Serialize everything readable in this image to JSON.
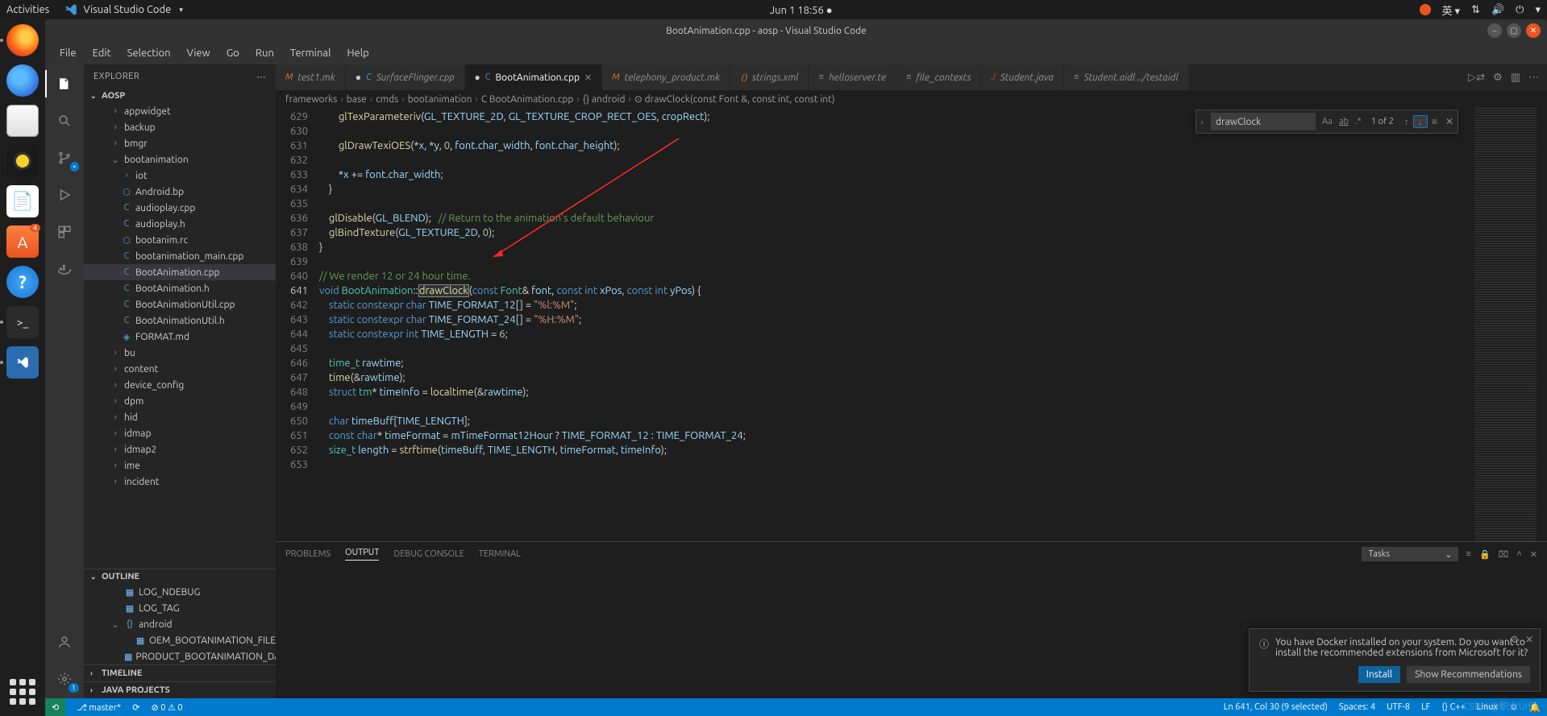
{
  "gnome": {
    "activities": "Activities",
    "app": "Visual Studio Code",
    "clock": "Jun 1  18:56",
    "lang": "英"
  },
  "window": {
    "title": "BootAnimation.cpp - aosp - Visual Studio Code"
  },
  "menu": [
    "File",
    "Edit",
    "Selection",
    "View",
    "Go",
    "Run",
    "Terminal",
    "Help"
  ],
  "explorer": {
    "title": "EXPLORER",
    "section": "AOSP",
    "items": [
      {
        "t": "appwidget",
        "d": 1,
        "k": "fold"
      },
      {
        "t": "backup",
        "d": 1,
        "k": "fold"
      },
      {
        "t": "bmgr",
        "d": 1,
        "k": "fold"
      },
      {
        "t": "bootanimation",
        "d": 1,
        "k": "open"
      },
      {
        "t": "iot",
        "d": 2,
        "k": "fold"
      },
      {
        "t": "Android.bp",
        "d": 2,
        "k": "file",
        "ic": "⬡",
        "cls": "ic-cpp"
      },
      {
        "t": "audioplay.cpp",
        "d": 2,
        "k": "file",
        "ic": "C",
        "cls": "ic-cpp"
      },
      {
        "t": "audioplay.h",
        "d": 2,
        "k": "file",
        "ic": "C",
        "cls": "ic-h"
      },
      {
        "t": "bootanim.rc",
        "d": 2,
        "k": "file",
        "ic": "⬡",
        "cls": "ic-cpp"
      },
      {
        "t": "bootanimation_main.cpp",
        "d": 2,
        "k": "file",
        "ic": "C",
        "cls": "ic-cpp"
      },
      {
        "t": "BootAnimation.cpp",
        "d": 2,
        "k": "file",
        "ic": "C",
        "cls": "ic-cpp",
        "sel": true
      },
      {
        "t": "BootAnimation.h",
        "d": 2,
        "k": "file",
        "ic": "C",
        "cls": "ic-h"
      },
      {
        "t": "BootAnimationUtil.cpp",
        "d": 2,
        "k": "file",
        "ic": "C",
        "cls": "ic-cpp"
      },
      {
        "t": "BootAnimationUtil.h",
        "d": 2,
        "k": "file",
        "ic": "C",
        "cls": "ic-h"
      },
      {
        "t": "FORMAT.md",
        "d": 2,
        "k": "file",
        "ic": "◈",
        "cls": "ic-md"
      },
      {
        "t": "bu",
        "d": 1,
        "k": "fold"
      },
      {
        "t": "content",
        "d": 1,
        "k": "fold"
      },
      {
        "t": "device_config",
        "d": 1,
        "k": "fold"
      },
      {
        "t": "dpm",
        "d": 1,
        "k": "fold"
      },
      {
        "t": "hid",
        "d": 1,
        "k": "fold"
      },
      {
        "t": "idmap",
        "d": 1,
        "k": "fold"
      },
      {
        "t": "idmap2",
        "d": 1,
        "k": "fold"
      },
      {
        "t": "ime",
        "d": 1,
        "k": "fold"
      },
      {
        "t": "incident",
        "d": 1,
        "k": "fold"
      }
    ],
    "outline": {
      "title": "OUTLINE",
      "items": [
        {
          "t": "LOG_NDEBUG",
          "ic": "▦"
        },
        {
          "t": "LOG_TAG",
          "ic": "▦"
        },
        {
          "t": "android",
          "ic": "{}",
          "open": true
        },
        {
          "t": "OEM_BOOTANIMATION_FILE",
          "ic": "▦",
          "d": 1
        },
        {
          "t": "PRODUCT_BOOTANIMATION_DARK_...",
          "ic": "▦",
          "d": 1
        }
      ]
    },
    "timeline": "TIMELINE",
    "java": "JAVA PROJECTS"
  },
  "tabs": [
    {
      "label": "test1.mk",
      "icon": "M",
      "color": "#e37933"
    },
    {
      "label": "SurfaceFlinger.cpp",
      "icon": "C",
      "color": "#519aba",
      "dirty": true
    },
    {
      "label": "BootAnimation.cpp",
      "icon": "C",
      "color": "#519aba",
      "active": true,
      "dirty": true,
      "close": true
    },
    {
      "label": "telephony_product.mk",
      "icon": "M",
      "color": "#e37933"
    },
    {
      "label": "strings.xml",
      "icon": "⟨⟩",
      "color": "#e37933"
    },
    {
      "label": "helloserver.te",
      "icon": "≡",
      "color": "#888"
    },
    {
      "label": "file_contexts",
      "icon": "≡",
      "color": "#888"
    },
    {
      "label": "Student.java",
      "icon": "J",
      "color": "#cc3e44"
    },
    {
      "label": "Student.aidl ../testaidl",
      "icon": "≡",
      "color": "#888"
    }
  ],
  "breadcrumb": [
    "frameworks",
    "base",
    "cmds",
    "bootanimation",
    "C BootAnimation.cpp",
    "{} android",
    "⊙ drawClock(const Font &, const int, const int)"
  ],
  "find": {
    "value": "drawClock",
    "count": "1 of 2"
  },
  "code": {
    "start": 629,
    "lines": [
      "        <span class='fn'>glTexParameteriv</span>(<span class='id'>GL_TEXTURE_2D</span>, <span class='id'>GL_TEXTURE_CROP_RECT_OES</span>, <span class='id'>cropRect</span>);",
      "",
      "        <span class='fn'>glDrawTexiOES</span>(*<span class='id'>x</span>, *<span class='id'>y</span>, <span class='num'>0</span>, <span class='id'>font</span>.<span class='id'>char_width</span>, <span class='id'>font</span>.<span class='id'>char_height</span>);",
      "",
      "        *<span class='id'>x</span> += <span class='id'>font</span>.<span class='id'>char_width</span>;",
      "    }",
      "",
      "    <span class='fn'>glDisable</span>(<span class='id'>GL_BLEND</span>);   <span class='cm'>// Return to the animation's default behaviour</span>",
      "    <span class='fn'>glBindTexture</span>(<span class='id'>GL_TEXTURE_2D</span>, <span class='num'>0</span>);",
      "}",
      "",
      "<span class='cm'>// We render 12 or 24 hour time.</span>",
      "<span class='kw'>void</span> <span class='ty'>BootAnimation</span>::<span class='fn hl'>drawClock</span>(<span class='kw'>const</span> <span class='ty'>Font</span>&amp; <span class='id'>font</span>, <span class='kw'>const</span> <span class='kw'>int</span> <span class='id'>xPos</span>, <span class='kw'>const</span> <span class='kw'>int</span> <span class='id'>yPos</span>) {",
      "    <span class='kw'>static</span> <span class='kw'>constexpr</span> <span class='kw'>char</span> <span class='id'>TIME_FORMAT_12</span>[] = <span class='str'>\"%l:%M\"</span>;",
      "    <span class='kw'>static</span> <span class='kw'>constexpr</span> <span class='kw'>char</span> <span class='id'>TIME_FORMAT_24</span>[] = <span class='str'>\"%H:%M\"</span>;",
      "    <span class='kw'>static</span> <span class='kw'>constexpr</span> <span class='kw'>int</span> <span class='id'>TIME_LENGTH</span> = <span class='num'>6</span>;",
      "",
      "    <span class='ty'>time_t</span> <span class='id'>rawtime</span>;",
      "    <span class='fn'>time</span>(&amp;<span class='id'>rawtime</span>);",
      "    <span class='kw'>struct</span> <span class='ty'>tm</span>* <span class='id'>timeInfo</span> = <span class='fn'>localtime</span>(&amp;<span class='id'>rawtime</span>);",
      "",
      "    <span class='kw'>char</span> <span class='id'>timeBuff</span>[<span class='id'>TIME_LENGTH</span>];",
      "    <span class='kw'>const</span> <span class='kw'>char</span>* <span class='id'>timeFormat</span> = <span class='id'>mTimeFormat12Hour</span> ? <span class='id'>TIME_FORMAT_12</span> : <span class='id'>TIME_FORMAT_24</span>;",
      "    <span class='ty'>size_t</span> <span class='id'>length</span> = <span class='fn'>strftime</span>(<span class='id'>timeBuff</span>, <span class='id'>TIME_LENGTH</span>, <span class='id'>timeFormat</span>, <span class='id'>timeInfo</span>);",
      ""
    ]
  },
  "panel": {
    "tabs": [
      "PROBLEMS",
      "OUTPUT",
      "DEBUG CONSOLE",
      "TERMINAL"
    ],
    "active": 1,
    "tasks": "Tasks"
  },
  "notif": {
    "msg": "You have Docker installed on your system. Do you want to install the recommended extensions from Microsoft for it?",
    "install": "Install",
    "show": "Show Recommendations"
  },
  "status": {
    "branch": "master*",
    "errors": "0",
    "warnings": "0",
    "pos": "Ln 641, Col 30 (9 selected)",
    "spaces": "Spaces: 4",
    "enc": "UTF-8",
    "eol": "LF",
    "lang": "C++",
    "os": "Linux"
  },
  "watermark": "CSDN @职业UI仔",
  "settings_badge": "1"
}
